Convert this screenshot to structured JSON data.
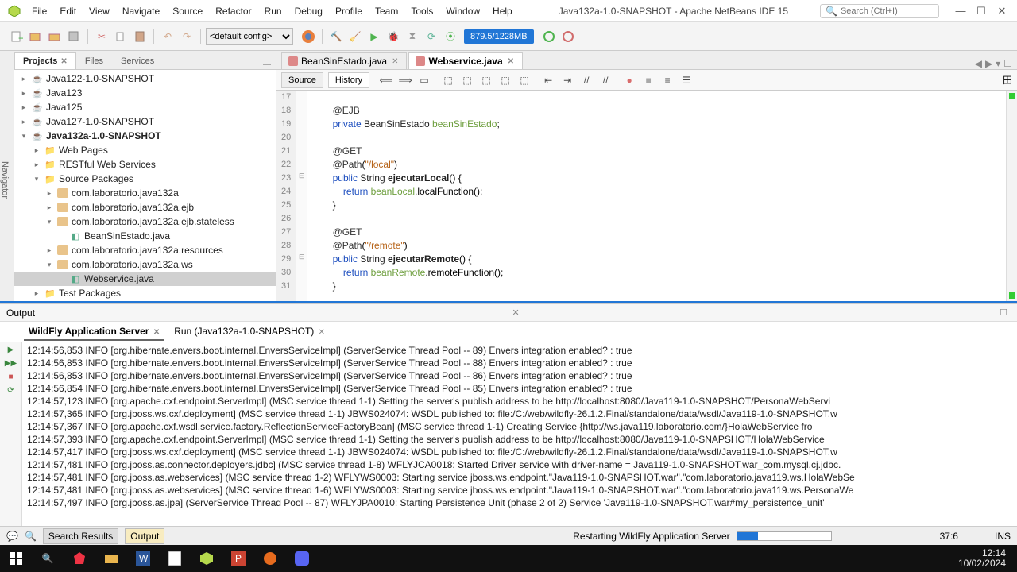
{
  "app": {
    "title": "Java132a-1.0-SNAPSHOT - Apache NetBeans IDE 15",
    "search_placeholder": "Search (Ctrl+I)"
  },
  "menu": [
    "File",
    "Edit",
    "View",
    "Navigate",
    "Source",
    "Refactor",
    "Run",
    "Debug",
    "Profile",
    "Team",
    "Tools",
    "Window",
    "Help"
  ],
  "toolbar": {
    "config_select": "<default config>",
    "memory": "879.5/1228MB"
  },
  "panels": {
    "tabs": [
      {
        "label": "Projects",
        "active": true,
        "closeable": true
      },
      {
        "label": "Files",
        "active": false,
        "closeable": false
      },
      {
        "label": "Services",
        "active": false,
        "closeable": false
      }
    ],
    "navigator_label": "Navigator"
  },
  "tree": [
    {
      "d": 0,
      "caret": "▸",
      "icon": "proj",
      "label": "Java122-1.0-SNAPSHOT"
    },
    {
      "d": 0,
      "caret": "▸",
      "icon": "proj",
      "label": "Java123"
    },
    {
      "d": 0,
      "caret": "▸",
      "icon": "proj",
      "label": "Java125"
    },
    {
      "d": 0,
      "caret": "▸",
      "icon": "proj",
      "label": "Java127-1.0-SNAPSHOT"
    },
    {
      "d": 0,
      "caret": "▾",
      "icon": "proj-bold",
      "label": "Java132a-1.0-SNAPSHOT"
    },
    {
      "d": 1,
      "caret": "▸",
      "icon": "folder",
      "label": "Web Pages"
    },
    {
      "d": 1,
      "caret": "▸",
      "icon": "folder",
      "label": "RESTful Web Services"
    },
    {
      "d": 1,
      "caret": "▾",
      "icon": "folder",
      "label": "Source Packages"
    },
    {
      "d": 2,
      "caret": "▸",
      "icon": "pkg",
      "label": "com.laboratorio.java132a"
    },
    {
      "d": 2,
      "caret": "▸",
      "icon": "pkg",
      "label": "com.laboratorio.java132a.ejb"
    },
    {
      "d": 2,
      "caret": "▾",
      "icon": "pkg",
      "label": "com.laboratorio.java132a.ejb.stateless"
    },
    {
      "d": 3,
      "caret": " ",
      "icon": "file",
      "label": "BeanSinEstado.java"
    },
    {
      "d": 2,
      "caret": "▸",
      "icon": "pkg",
      "label": "com.laboratorio.java132a.resources"
    },
    {
      "d": 2,
      "caret": "▾",
      "icon": "pkg",
      "label": "com.laboratorio.java132a.ws"
    },
    {
      "d": 3,
      "caret": " ",
      "icon": "file",
      "label": "Webservice.java",
      "selected": true
    },
    {
      "d": 1,
      "caret": "▸",
      "icon": "folder",
      "label": "Test Packages"
    },
    {
      "d": 1,
      "caret": "▸",
      "icon": "folder",
      "label": "Other Sources"
    }
  ],
  "editor": {
    "tabs": [
      {
        "label": "BeanSinEstado.java",
        "active": false
      },
      {
        "label": "Webservice.java",
        "active": true
      }
    ],
    "modes": {
      "source": "Source",
      "history": "History"
    },
    "lines": [
      {
        "n": 17,
        "html": ""
      },
      {
        "n": 18,
        "html": "    <span class='ann'>@EJB</span>"
      },
      {
        "n": 19,
        "html": "    <span class='kw'>private</span> <span class='typ'>BeanSinEstado</span> <span class='var'>beanSinEstado</span>;"
      },
      {
        "n": 20,
        "html": ""
      },
      {
        "n": 21,
        "html": "    <span class='ann'>@GET</span>"
      },
      {
        "n": 22,
        "html": "    <span class='ann'>@Path</span>(<span class='str'>\"/local\"</span>)"
      },
      {
        "n": 23,
        "html": "    <span class='kw'>public</span> <span class='typ'>String</span> <span class='fn'>ejecutarLocal</span>() {"
      },
      {
        "n": 24,
        "html": "        <span class='kw'>return</span> <span class='var'>beanLocal</span>.localFunction();"
      },
      {
        "n": 25,
        "html": "    }"
      },
      {
        "n": 26,
        "html": ""
      },
      {
        "n": 27,
        "html": "    <span class='ann'>@GET</span>"
      },
      {
        "n": 28,
        "html": "    <span class='ann'>@Path</span>(<span class='str'>\"/remote\"</span>)"
      },
      {
        "n": 29,
        "html": "    <span class='kw'>public</span> <span class='typ'>String</span> <span class='fn'>ejecutarRemote</span>() {"
      },
      {
        "n": 30,
        "html": "        <span class='kw'>return</span> <span class='var'>beanRemote</span>.remoteFunction();"
      },
      {
        "n": 31,
        "html": "    }"
      }
    ]
  },
  "output": {
    "title": "Output",
    "tabs": [
      {
        "label": "WildFly Application Server",
        "active": true
      },
      {
        "label": "Run (Java132a-1.0-SNAPSHOT)",
        "active": false
      }
    ],
    "log": [
      "12:14:56,853 INFO  [org.hibernate.envers.boot.internal.EnversServiceImpl] (ServerService Thread Pool -- 89) Envers integration enabled? : true",
      "12:14:56,853 INFO  [org.hibernate.envers.boot.internal.EnversServiceImpl] (ServerService Thread Pool -- 88) Envers integration enabled? : true",
      "12:14:56,853 INFO  [org.hibernate.envers.boot.internal.EnversServiceImpl] (ServerService Thread Pool -- 86) Envers integration enabled? : true",
      "12:14:56,854 INFO  [org.hibernate.envers.boot.internal.EnversServiceImpl] (ServerService Thread Pool -- 85) Envers integration enabled? : true",
      "12:14:57,123 INFO  [org.apache.cxf.endpoint.ServerImpl] (MSC service thread 1-1) Setting the server's publish address to be http://localhost:8080/Java119-1.0-SNAPSHOT/PersonaWebServi",
      "12:14:57,365 INFO  [org.jboss.ws.cxf.deployment] (MSC service thread 1-1) JBWS024074: WSDL published to: file:/C:/web/wildfly-26.1.2.Final/standalone/data/wsdl/Java119-1.0-SNAPSHOT.w",
      "12:14:57,367 INFO  [org.apache.cxf.wsdl.service.factory.ReflectionServiceFactoryBean] (MSC service thread 1-1) Creating Service {http://ws.java119.laboratorio.com/}HolaWebService fro",
      "12:14:57,393 INFO  [org.apache.cxf.endpoint.ServerImpl] (MSC service thread 1-1) Setting the server's publish address to be http://localhost:8080/Java119-1.0-SNAPSHOT/HolaWebService",
      "12:14:57,417 INFO  [org.jboss.ws.cxf.deployment] (MSC service thread 1-1) JBWS024074: WSDL published to: file:/C:/web/wildfly-26.1.2.Final/standalone/data/wsdl/Java119-1.0-SNAPSHOT.w",
      "12:14:57,481 INFO  [org.jboss.as.connector.deployers.jdbc] (MSC service thread 1-8) WFLYJCA0018: Started Driver service with driver-name = Java119-1.0-SNAPSHOT.war_com.mysql.cj.jdbc.",
      "12:14:57,481 INFO  [org.jboss.as.webservices] (MSC service thread 1-2) WFLYWS0003: Starting service jboss.ws.endpoint.\"Java119-1.0-SNAPSHOT.war\".\"com.laboratorio.java119.ws.HolaWebSe",
      "12:14:57,481 INFO  [org.jboss.as.webservices] (MSC service thread 1-6) WFLYWS0003: Starting service jboss.ws.endpoint.\"Java119-1.0-SNAPSHOT.war\".\"com.laboratorio.java119.ws.PersonaWe",
      "12:14:57,497 INFO  [org.jboss.as.jpa] (ServerService Thread Pool -- 87) WFLYJPA0010: Starting Persistence Unit (phase 2 of 2) Service 'Java119-1.0-SNAPSHOT.war#my_persistence_unit'"
    ]
  },
  "status": {
    "search_results": "Search Results",
    "output": "Output",
    "msg": "Restarting WildFly Application Server",
    "pos": "37:6",
    "ins": "INS"
  },
  "taskbar": {
    "time": "12:14",
    "date": "10/02/2024"
  }
}
